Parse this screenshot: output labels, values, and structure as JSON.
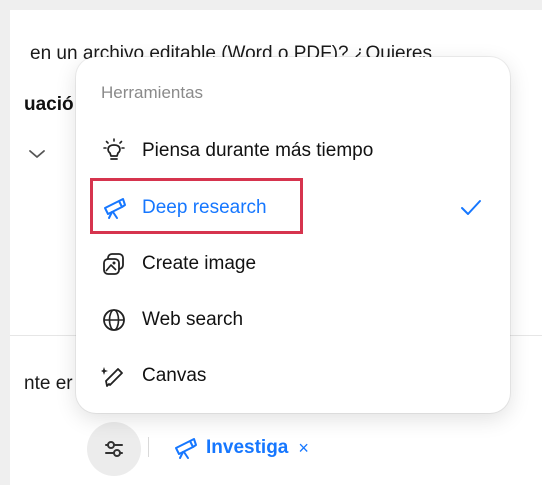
{
  "background": {
    "line1": "en un archivo editable (Word o PDF)? ¿Quieres",
    "bold_fragment": "uació",
    "line2": "nte er"
  },
  "menu": {
    "heading": "Herramientas",
    "items": [
      {
        "label": "Piensa durante más tiempo",
        "icon": "lightbulb-icon",
        "selected": false
      },
      {
        "label": "Deep research",
        "icon": "telescope-icon",
        "selected": true
      },
      {
        "label": "Create image",
        "icon": "image-stack-icon",
        "selected": false
      },
      {
        "label": "Web search",
        "icon": "globe-icon",
        "selected": false
      },
      {
        "label": "Canvas",
        "icon": "pen-sparkle-icon",
        "selected": false
      }
    ]
  },
  "composer": {
    "tools_button": "sliders-icon",
    "chip_label": "Investiga",
    "chip_remove": "×"
  },
  "colors": {
    "accent": "#1677ff",
    "highlight": "#d6344e",
    "muted": "#8a8a8a"
  }
}
